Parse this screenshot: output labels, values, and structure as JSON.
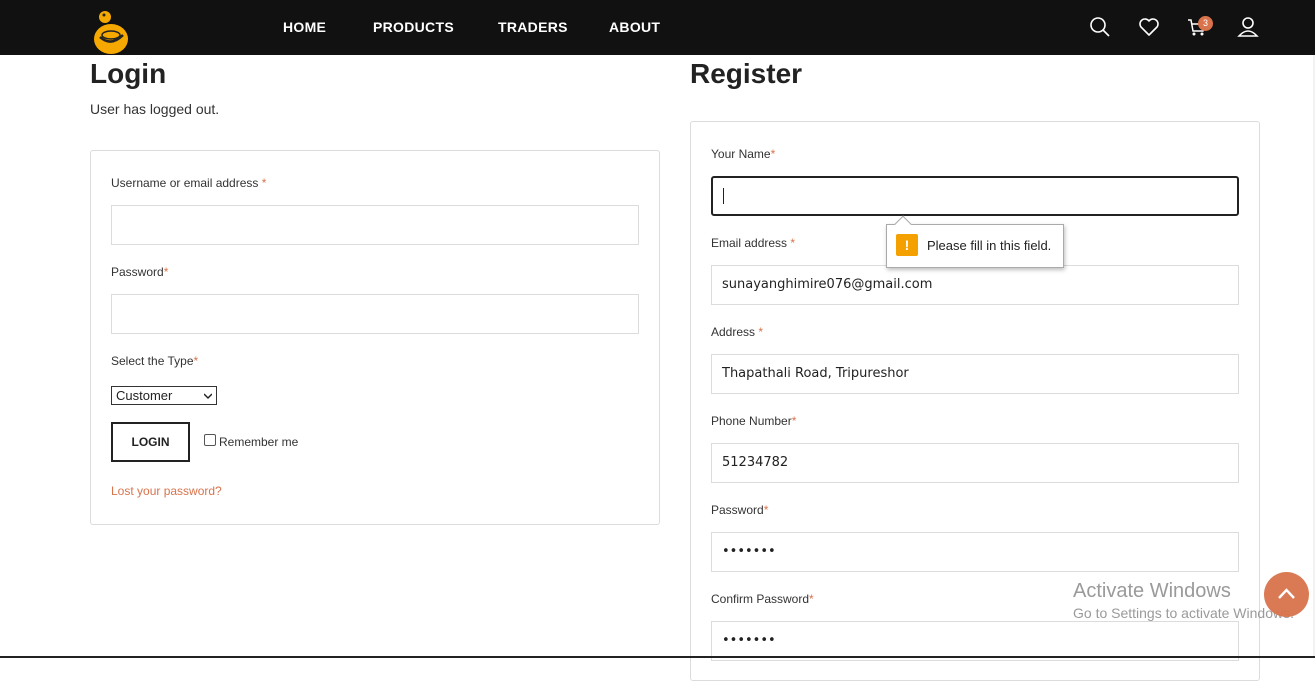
{
  "header": {
    "nav": [
      "HOME",
      "PRODUCTS",
      "TRADERS",
      "ABOUT"
    ],
    "cart_count": "3",
    "icons": [
      "logo-icon",
      "search-icon",
      "heart-icon",
      "cart-icon",
      "user-icon"
    ]
  },
  "login": {
    "title": "Login",
    "message": "User has logged out.",
    "username_label": "Username or email address",
    "password_label": "Password",
    "type_label": "Select the Type",
    "type_selected": "Customer",
    "button": "LOGIN",
    "remember": "Remember me",
    "lost_password": "Lost your password?",
    "required": "*"
  },
  "register": {
    "title": "Register",
    "name_label": "Your Name",
    "name_value": "",
    "email_label": "Email address",
    "email_value": "sunayanghimire076@gmail.com",
    "address_label": "Address",
    "address_value": "Thapathali Road, Tripureshor",
    "phone_label": "Phone Number",
    "phone_value": "51234782",
    "password_label": "Password",
    "password_value": "•••••••",
    "confirm_label": "Confirm Password",
    "confirm_value": "•••••••",
    "required": "*"
  },
  "tooltip": {
    "text": "Please fill in this field.",
    "icon": "!"
  },
  "watermark": {
    "line1": "Activate Windows",
    "line2": "Go to Settings to activate Windows."
  },
  "colors": {
    "accent": "#d9734c",
    "header_bg": "#111111",
    "warning": "#f4a100"
  }
}
